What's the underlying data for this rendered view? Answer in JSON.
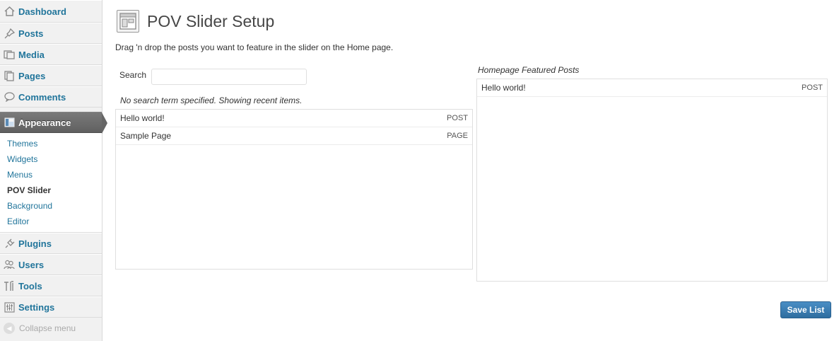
{
  "sidebar": {
    "items": [
      {
        "label": "Dashboard",
        "icon": "dashboard-icon"
      },
      {
        "label": "Posts",
        "icon": "pin-icon"
      },
      {
        "label": "Media",
        "icon": "media-icon"
      },
      {
        "label": "Pages",
        "icon": "pages-icon"
      },
      {
        "label": "Comments",
        "icon": "comment-icon"
      },
      {
        "label": "Appearance",
        "icon": "appearance-icon",
        "current": true
      },
      {
        "label": "Plugins",
        "icon": "plug-icon"
      },
      {
        "label": "Users",
        "icon": "users-icon"
      },
      {
        "label": "Tools",
        "icon": "tools-icon"
      },
      {
        "label": "Settings",
        "icon": "settings-icon"
      }
    ],
    "submenu": [
      "Themes",
      "Widgets",
      "Menus",
      "POV Slider",
      "Background",
      "Editor"
    ],
    "submenu_active": "POV Slider",
    "collapse_label": "Collapse menu"
  },
  "page": {
    "title": "POV Slider Setup",
    "intro": "Drag 'n drop the posts you want to feature in the slider on the Home page."
  },
  "search": {
    "label": "Search",
    "value": "",
    "status": "No search term specified. Showing recent items."
  },
  "results": [
    {
      "title": "Hello world!",
      "type": "POST"
    },
    {
      "title": "Sample Page",
      "type": "PAGE"
    }
  ],
  "featured": {
    "heading": "Homepage Featured Posts",
    "items": [
      {
        "title": "Hello world!",
        "type": "POST"
      }
    ]
  },
  "actions": {
    "save_label": "Save List"
  },
  "colors": {
    "link": "#21759b",
    "button": "#2e6d9f",
    "current_menu": "#6a6a6a"
  }
}
